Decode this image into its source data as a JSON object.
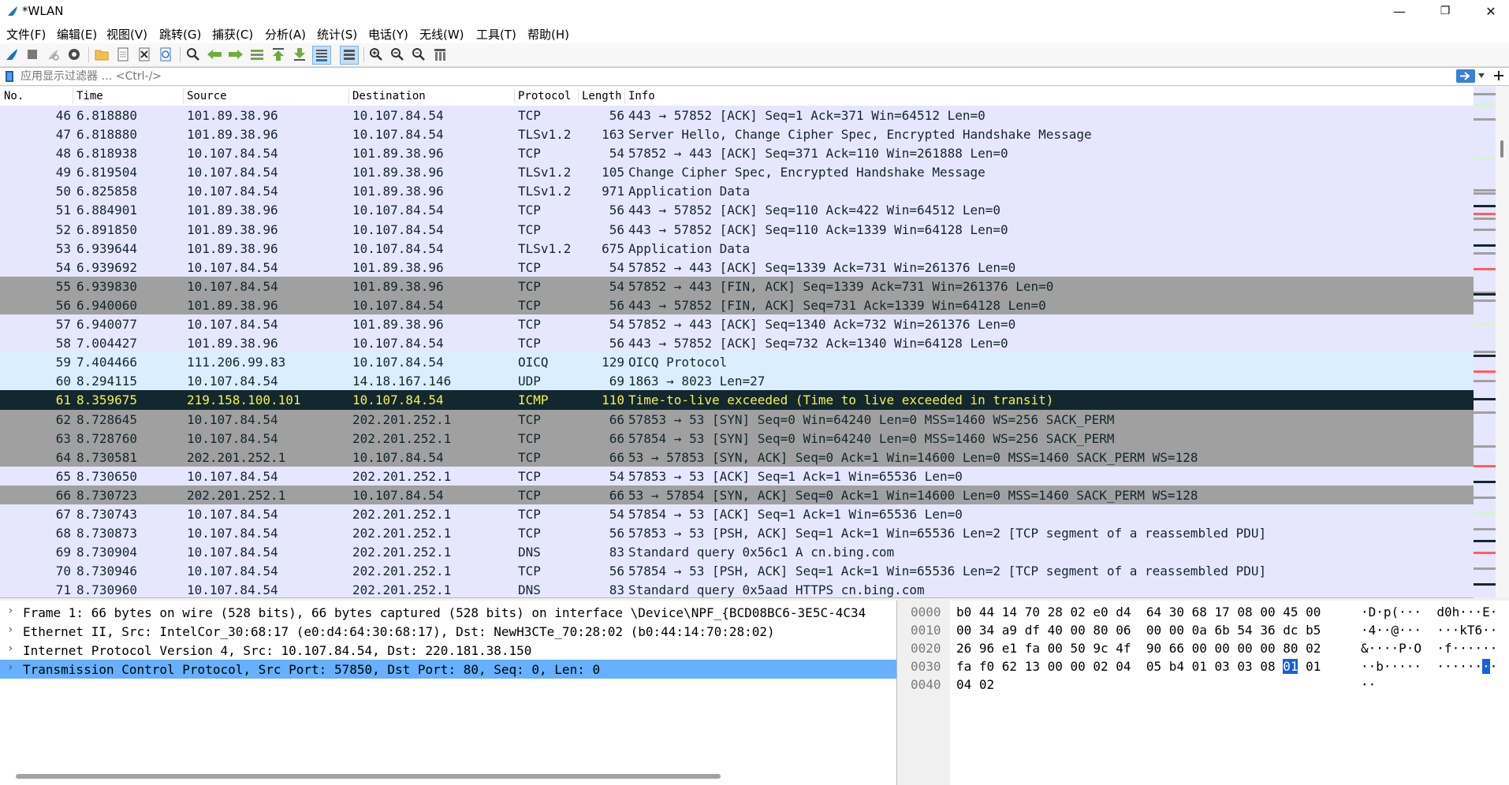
{
  "window": {
    "title": "*WLAN",
    "controls": {
      "minimize": "—",
      "maximize": "❐",
      "close": "✕"
    }
  },
  "menu": [
    "文件(F)",
    "编辑(E)",
    "视图(V)",
    "跳转(G)",
    "捕获(C)",
    "分析(A)",
    "统计(S)",
    "电话(Y)",
    "无线(W)",
    "工具(T)",
    "帮助(H)"
  ],
  "toolbar": {
    "icons": [
      "shark-fin-start-icon",
      "stop-capture-icon",
      "restart-capture-icon",
      "capture-options-icon",
      "open-file-icon",
      "save-file-icon",
      "close-file-icon",
      "reload-icon",
      "find-packet-icon",
      "go-back-icon",
      "go-forward-icon",
      "go-to-packet-icon",
      "go-first-icon",
      "go-last-icon",
      "autoscroll-icon",
      "colorize-icon",
      "zoom-in-icon",
      "zoom-out-icon",
      "zoom-reset-icon",
      "resize-columns-icon"
    ]
  },
  "filter": {
    "placeholder": "应用显示过滤器 … <Ctrl-/>",
    "apply_icon": "arrow-right-icon",
    "add_icon": "plus-icon"
  },
  "packet_list": {
    "columns": [
      "No.",
      "Time",
      "Source",
      "Destination",
      "Protocol",
      "Length",
      "Info"
    ],
    "rows": [
      {
        "no": "46",
        "time": "6.818880",
        "src": "101.89.38.96",
        "dst": "10.107.84.54",
        "proto": "TCP",
        "len": "56",
        "info": "443 → 57852 [ACK] Seq=1 Ack=371 Win=64512 Len=0",
        "bg": "#e7e6ff",
        "fg": "#12272e"
      },
      {
        "no": "47",
        "time": "6.818880",
        "src": "101.89.38.96",
        "dst": "10.107.84.54",
        "proto": "TLSv1.2",
        "len": "163",
        "info": "Server Hello, Change Cipher Spec, Encrypted Handshake Message",
        "bg": "#e7e6ff",
        "fg": "#12272e"
      },
      {
        "no": "48",
        "time": "6.818938",
        "src": "10.107.84.54",
        "dst": "101.89.38.96",
        "proto": "TCP",
        "len": "54",
        "info": "57852 → 443 [ACK] Seq=371 Ack=110 Win=261888 Len=0",
        "bg": "#e7e6ff",
        "fg": "#12272e"
      },
      {
        "no": "49",
        "time": "6.819504",
        "src": "10.107.84.54",
        "dst": "101.89.38.96",
        "proto": "TLSv1.2",
        "len": "105",
        "info": "Change Cipher Spec, Encrypted Handshake Message",
        "bg": "#e7e6ff",
        "fg": "#12272e"
      },
      {
        "no": "50",
        "time": "6.825858",
        "src": "10.107.84.54",
        "dst": "101.89.38.96",
        "proto": "TLSv1.2",
        "len": "971",
        "info": "Application Data",
        "bg": "#e7e6ff",
        "fg": "#12272e"
      },
      {
        "no": "51",
        "time": "6.884901",
        "src": "101.89.38.96",
        "dst": "10.107.84.54",
        "proto": "TCP",
        "len": "56",
        "info": "443 → 57852 [ACK] Seq=110 Ack=422 Win=64512 Len=0",
        "bg": "#e7e6ff",
        "fg": "#12272e"
      },
      {
        "no": "52",
        "time": "6.891850",
        "src": "101.89.38.96",
        "dst": "10.107.84.54",
        "proto": "TCP",
        "len": "56",
        "info": "443 → 57852 [ACK] Seq=110 Ack=1339 Win=64128 Len=0",
        "bg": "#e7e6ff",
        "fg": "#12272e"
      },
      {
        "no": "53",
        "time": "6.939644",
        "src": "101.89.38.96",
        "dst": "10.107.84.54",
        "proto": "TLSv1.2",
        "len": "675",
        "info": "Application Data",
        "bg": "#e7e6ff",
        "fg": "#12272e"
      },
      {
        "no": "54",
        "time": "6.939692",
        "src": "10.107.84.54",
        "dst": "101.89.38.96",
        "proto": "TCP",
        "len": "54",
        "info": "57852 → 443 [ACK] Seq=1339 Ack=731 Win=261376 Len=0",
        "bg": "#e7e6ff",
        "fg": "#12272e"
      },
      {
        "no": "55",
        "time": "6.939830",
        "src": "10.107.84.54",
        "dst": "101.89.38.96",
        "proto": "TCP",
        "len": "54",
        "info": "57852 → 443 [FIN, ACK] Seq=1339 Ack=731 Win=261376 Len=0",
        "bg": "#a0a0a0",
        "fg": "#12272e"
      },
      {
        "no": "56",
        "time": "6.940060",
        "src": "101.89.38.96",
        "dst": "10.107.84.54",
        "proto": "TCP",
        "len": "56",
        "info": "443 → 57852 [FIN, ACK] Seq=731 Ack=1339 Win=64128 Len=0",
        "bg": "#a0a0a0",
        "fg": "#12272e"
      },
      {
        "no": "57",
        "time": "6.940077",
        "src": "10.107.84.54",
        "dst": "101.89.38.96",
        "proto": "TCP",
        "len": "54",
        "info": "57852 → 443 [ACK] Seq=1340 Ack=732 Win=261376 Len=0",
        "bg": "#e7e6ff",
        "fg": "#12272e"
      },
      {
        "no": "58",
        "time": "7.004427",
        "src": "101.89.38.96",
        "dst": "10.107.84.54",
        "proto": "TCP",
        "len": "56",
        "info": "443 → 57852 [ACK] Seq=732 Ack=1340 Win=64128 Len=0",
        "bg": "#e7e6ff",
        "fg": "#12272e"
      },
      {
        "no": "59",
        "time": "7.404466",
        "src": "111.206.99.83",
        "dst": "10.107.84.54",
        "proto": "OICQ",
        "len": "129",
        "info": "OICQ Protocol",
        "bg": "#daeeff",
        "fg": "#12272e"
      },
      {
        "no": "60",
        "time": "8.294115",
        "src": "10.107.84.54",
        "dst": "14.18.167.146",
        "proto": "UDP",
        "len": "69",
        "info": "1863 → 8023 Len=27",
        "bg": "#daeeff",
        "fg": "#12272e"
      },
      {
        "no": "61",
        "time": "8.359675",
        "src": "219.158.100.101",
        "dst": "10.107.84.54",
        "proto": "ICMP",
        "len": "110",
        "info": "Time-to-live exceeded (Time to live exceeded in transit)",
        "bg": "#12272e",
        "fg": "#f7f050"
      },
      {
        "no": "62",
        "time": "8.728645",
        "src": "10.107.84.54",
        "dst": "202.201.252.1",
        "proto": "TCP",
        "len": "66",
        "info": "57853 → 53 [SYN] Seq=0 Win=64240 Len=0 MSS=1460 WS=256 SACK_PERM",
        "bg": "#a0a0a0",
        "fg": "#12272e"
      },
      {
        "no": "63",
        "time": "8.728760",
        "src": "10.107.84.54",
        "dst": "202.201.252.1",
        "proto": "TCP",
        "len": "66",
        "info": "57854 → 53 [SYN] Seq=0 Win=64240 Len=0 MSS=1460 WS=256 SACK_PERM",
        "bg": "#a0a0a0",
        "fg": "#12272e"
      },
      {
        "no": "64",
        "time": "8.730581",
        "src": "202.201.252.1",
        "dst": "10.107.84.54",
        "proto": "TCP",
        "len": "66",
        "info": "53 → 57853 [SYN, ACK] Seq=0 Ack=1 Win=14600 Len=0 MSS=1460 SACK_PERM WS=128",
        "bg": "#a0a0a0",
        "fg": "#12272e"
      },
      {
        "no": "65",
        "time": "8.730650",
        "src": "10.107.84.54",
        "dst": "202.201.252.1",
        "proto": "TCP",
        "len": "54",
        "info": "57853 → 53 [ACK] Seq=1 Ack=1 Win=65536 Len=0",
        "bg": "#e7e6ff",
        "fg": "#12272e"
      },
      {
        "no": "66",
        "time": "8.730723",
        "src": "202.201.252.1",
        "dst": "10.107.84.54",
        "proto": "TCP",
        "len": "66",
        "info": "53 → 57854 [SYN, ACK] Seq=0 Ack=1 Win=14600 Len=0 MSS=1460 SACK_PERM WS=128",
        "bg": "#a0a0a0",
        "fg": "#12272e"
      },
      {
        "no": "67",
        "time": "8.730743",
        "src": "10.107.84.54",
        "dst": "202.201.252.1",
        "proto": "TCP",
        "len": "54",
        "info": "57854 → 53 [ACK] Seq=1 Ack=1 Win=65536 Len=0",
        "bg": "#e7e6ff",
        "fg": "#12272e"
      },
      {
        "no": "68",
        "time": "8.730873",
        "src": "10.107.84.54",
        "dst": "202.201.252.1",
        "proto": "TCP",
        "len": "56",
        "info": "57853 → 53 [PSH, ACK] Seq=1 Ack=1 Win=65536 Len=2 [TCP segment of a reassembled PDU]",
        "bg": "#e7e6ff",
        "fg": "#12272e"
      },
      {
        "no": "69",
        "time": "8.730904",
        "src": "10.107.84.54",
        "dst": "202.201.252.1",
        "proto": "DNS",
        "len": "83",
        "info": "Standard query 0x56c1 A cn.bing.com",
        "bg": "#e7e6ff",
        "fg": "#12272e"
      },
      {
        "no": "70",
        "time": "8.730946",
        "src": "10.107.84.54",
        "dst": "202.201.252.1",
        "proto": "TCP",
        "len": "56",
        "info": "57854 → 53 [PSH, ACK] Seq=1 Ack=1 Win=65536 Len=2 [TCP segment of a reassembled PDU]",
        "bg": "#e7e6ff",
        "fg": "#12272e"
      },
      {
        "no": "71",
        "time": "8.730960",
        "src": "10.107.84.54",
        "dst": "202.201.252.1",
        "proto": "DNS",
        "len": "83",
        "info": "Standard query 0x5aad HTTPS cn.bing.com",
        "bg": "#e7e6ff",
        "fg": "#12272e"
      }
    ]
  },
  "details": [
    {
      "text": "Frame 1: 66 bytes on wire (528 bits), 66 bytes captured (528 bits) on interface \\Device\\NPF_{BCD08BC6-3E5C-4C34",
      "selected": false
    },
    {
      "text": "Ethernet II, Src: IntelCor_30:68:17 (e0:d4:64:30:68:17), Dst: NewH3CTe_70:28:02 (b0:44:14:70:28:02)",
      "selected": false
    },
    {
      "text": "Internet Protocol Version 4, Src: 10.107.84.54, Dst: 220.181.38.150",
      "selected": false
    },
    {
      "text": "Transmission Control Protocol, Src Port: 57850, Dst Port: 80, Seq: 0, Len: 0",
      "selected": true
    }
  ],
  "bytes": [
    {
      "off": "0000",
      "hex_a": "b0 44 14 70 28 02 e0 d4  64 30 68 17 08 00 45 00",
      "hex_hl": "",
      "hex_b": "",
      "ascii_a": "·D·p(···  d0h···E·",
      "ascii_hl": "",
      "ascii_b": ""
    },
    {
      "off": "0010",
      "hex_a": "00 34 a9 df 40 00 80 06  00 00 0a 6b 54 36 dc b5",
      "hex_hl": "",
      "hex_b": "",
      "ascii_a": "·4··@···  ···kT6··",
      "ascii_hl": "",
      "ascii_b": ""
    },
    {
      "off": "0020",
      "hex_a": "26 96 e1 fa 00 50 9c 4f  90 66 00 00 00 00 80 02",
      "hex_hl": "",
      "hex_b": "",
      "ascii_a": "&····P·O  ·f······",
      "ascii_hl": "",
      "ascii_b": ""
    },
    {
      "off": "0030",
      "hex_a": "fa f0 62 13 00 00 02 04  05 b4 01 03 03 08 ",
      "hex_hl": "01",
      "hex_b": " 01",
      "ascii_a": "··b·····  ······",
      "ascii_hl": "·",
      "ascii_b": "·"
    },
    {
      "off": "0040",
      "hex_a": "04 02",
      "hex_hl": "",
      "hex_b": "",
      "ascii_a": "··",
      "ascii_hl": "",
      "ascii_b": ""
    }
  ]
}
